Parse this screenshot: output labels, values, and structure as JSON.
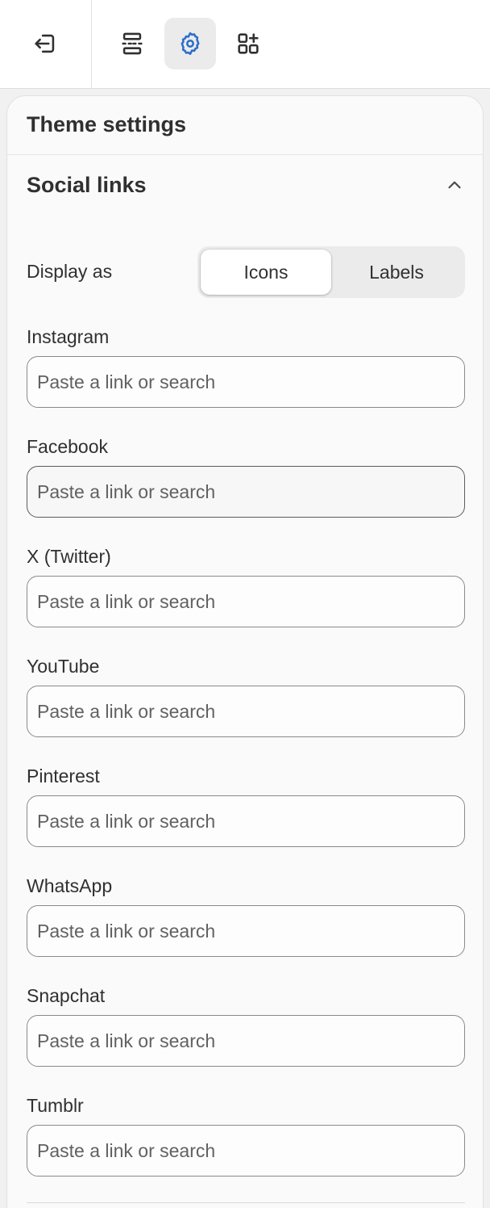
{
  "toolbar": {
    "exit_icon": "exit-icon",
    "sections_icon": "sections-icon",
    "settings_icon": "gear-icon",
    "apps_icon": "apps-icon",
    "active_color": "#2c6ecb"
  },
  "panel": {
    "title": "Theme settings"
  },
  "section": {
    "title": "Social links",
    "expanded": true
  },
  "display_as": {
    "label": "Display as",
    "options": [
      "Icons",
      "Labels"
    ],
    "selected": "Icons"
  },
  "fields": [
    {
      "label": "Instagram",
      "placeholder": "Paste a link or search",
      "value": ""
    },
    {
      "label": "Facebook",
      "placeholder": "Paste a link or search",
      "value": ""
    },
    {
      "label": "X (Twitter)",
      "placeholder": "Paste a link or search",
      "value": ""
    },
    {
      "label": "YouTube",
      "placeholder": "Paste a link or search",
      "value": ""
    },
    {
      "label": "Pinterest",
      "placeholder": "Paste a link or search",
      "value": ""
    },
    {
      "label": "WhatsApp",
      "placeholder": "Paste a link or search",
      "value": ""
    },
    {
      "label": "Snapchat",
      "placeholder": "Paste a link or search",
      "value": ""
    },
    {
      "label": "Tumblr",
      "placeholder": "Paste a link or search",
      "value": ""
    }
  ]
}
